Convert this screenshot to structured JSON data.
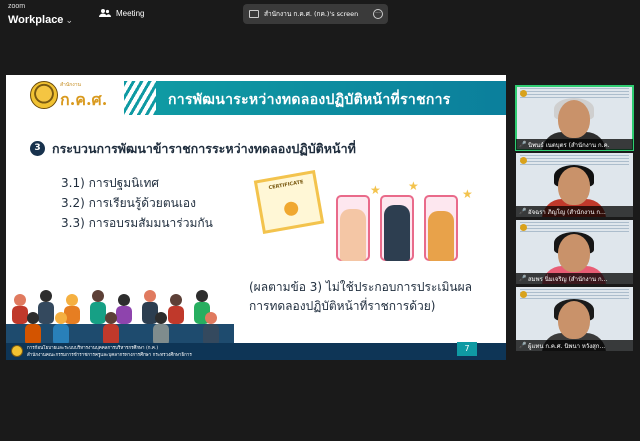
{
  "app": {
    "logo_top": "zoom",
    "logo_bottom": "Workplace",
    "meeting_label": "Meeting"
  },
  "share": {
    "label": "สำนักงาน ก.ค.ศ. (กค.)'s screen",
    "more": "···"
  },
  "slide": {
    "logo_small": "สำนักงาน",
    "logo_big": "ก.ค.ศ.",
    "title": "การพัฒนาระหว่างทดลองปฏิบัติหน้าที่ราชการ",
    "section_number": "3",
    "section_heading": "กระบวนการพัฒนาข้าราชการระหว่างทดลองปฏิบัติหน้าที่",
    "items": [
      "3.1) การปฐมนิเทศ",
      "3.2) การเรียนรู้ด้วยตนเอง",
      "3.3) การอบรมสัมมนาร่วมกัน"
    ],
    "note_line1": "(ผลตามข้อ 3) ไม่ใช้ประกอบการประเมินผล",
    "note_line2": "การทดลองปฏิบัติหน้าที่ราชการด้วย)",
    "certificate_text": "CERTIFICATE",
    "footer_line1": "การก้อนโยบายและระบบบริหารงานบุคคลการบริหารกรศึกษา (ก.ค.)",
    "footer_line2": "สำนักงานคณะกรรมการข้าราชการครูและบุคลากรทางการศึกษา กระทรวงศึกษาธิการ",
    "page_number": "7",
    "next_arrows": "»»»"
  },
  "participants": [
    {
      "name": "นิพนธ์ เนตบุตร (สำนักงาน ก.ค.",
      "active": true,
      "shirt": "#2d2d2d",
      "hair": "#cfcfcf"
    },
    {
      "name": "อัจฉรา ภิญโญ (สำนักงาน ก...",
      "active": false,
      "shirt": "#c0392b",
      "hair": "#111111"
    },
    {
      "name": "สมพร นิ่มเจริญ (สำนักงาน ก...",
      "active": false,
      "shirt": "#e85d75",
      "hair": "#161616"
    },
    {
      "name": "ผู้แทน ก.ค.ศ. นิพนา หวังสุก...",
      "active": false,
      "shirt": "#3a3a3a",
      "hair": "#1a1a1a"
    }
  ]
}
